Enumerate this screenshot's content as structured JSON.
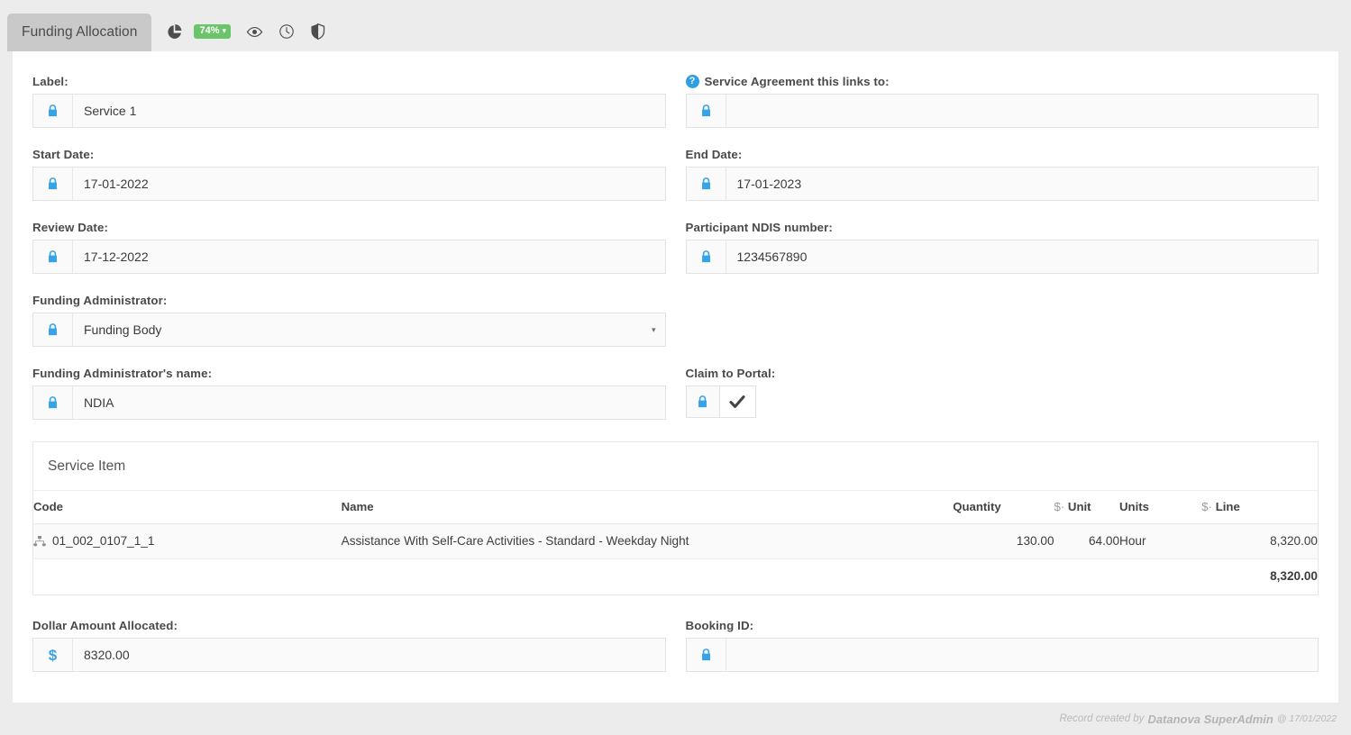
{
  "tabbar": {
    "active_tab": "Funding Allocation",
    "icons": [
      {
        "name": "pie-chart-icon",
        "glyph": "pie"
      },
      {
        "name": "percent-badge",
        "glyph": "badge"
      },
      {
        "name": "eye-icon",
        "glyph": "eye"
      },
      {
        "name": "clock-icon",
        "glyph": "clock"
      },
      {
        "name": "shield-icon",
        "glyph": "shield"
      }
    ],
    "percent_badge": {
      "value": "74%",
      "color": "#6ac46a"
    }
  },
  "form": {
    "label": {
      "label": "Label:",
      "value": "Service 1",
      "addon": "lock-icon"
    },
    "service_agreement": {
      "label": "Service Agreement this links to:",
      "value": "",
      "addon": "lock-icon",
      "help": "?"
    },
    "start_date": {
      "label": "Start Date:",
      "value": "17-01-2022",
      "addon": "lock-icon"
    },
    "end_date": {
      "label": "End Date:",
      "value": "17-01-2023",
      "addon": "lock-icon"
    },
    "review_date": {
      "label": "Review Date:",
      "value": "17-12-2022",
      "addon": "lock-icon"
    },
    "ndis_number": {
      "label": "Participant NDIS number:",
      "value": "1234567890",
      "addon": "lock-icon"
    },
    "funding_administrator": {
      "label": "Funding Administrator:",
      "value": "Funding Body",
      "addon": "lock-icon"
    },
    "funding_admin_name": {
      "label": "Funding Administrator's name:",
      "value": "NDIA",
      "addon": "lock-icon"
    },
    "claim_to_portal": {
      "label": "Claim to Portal:",
      "checked": true,
      "addon": "lock-icon"
    },
    "dollar_amount": {
      "label": "Dollar Amount Allocated:",
      "value": "8320.00",
      "addon": "dollar-icon"
    },
    "booking_id": {
      "label": "Booking ID:",
      "value": "",
      "addon": "lock-icon"
    }
  },
  "service_item": {
    "title": "Service Item",
    "columns": {
      "code": "Code",
      "name": "Name",
      "quantity": "Quantity",
      "unit_dollar": "$",
      "unit_sep": "·",
      "unit": "Unit",
      "units": "Units",
      "line_dollar": "$",
      "line_sep": "·",
      "line": "Line"
    },
    "rows": [
      {
        "code": "01_002_0107_1_1",
        "name": "Assistance With Self-Care Activities - Standard - Weekday Night",
        "quantity": "130.00",
        "unit": "64.00",
        "units": "Hour",
        "line": "8,320.00"
      }
    ],
    "total": "8,320.00"
  },
  "footer": {
    "prefix": "Record created by",
    "user": "Datanova SuperAdmin",
    "at": "@ 17/01/2022"
  }
}
